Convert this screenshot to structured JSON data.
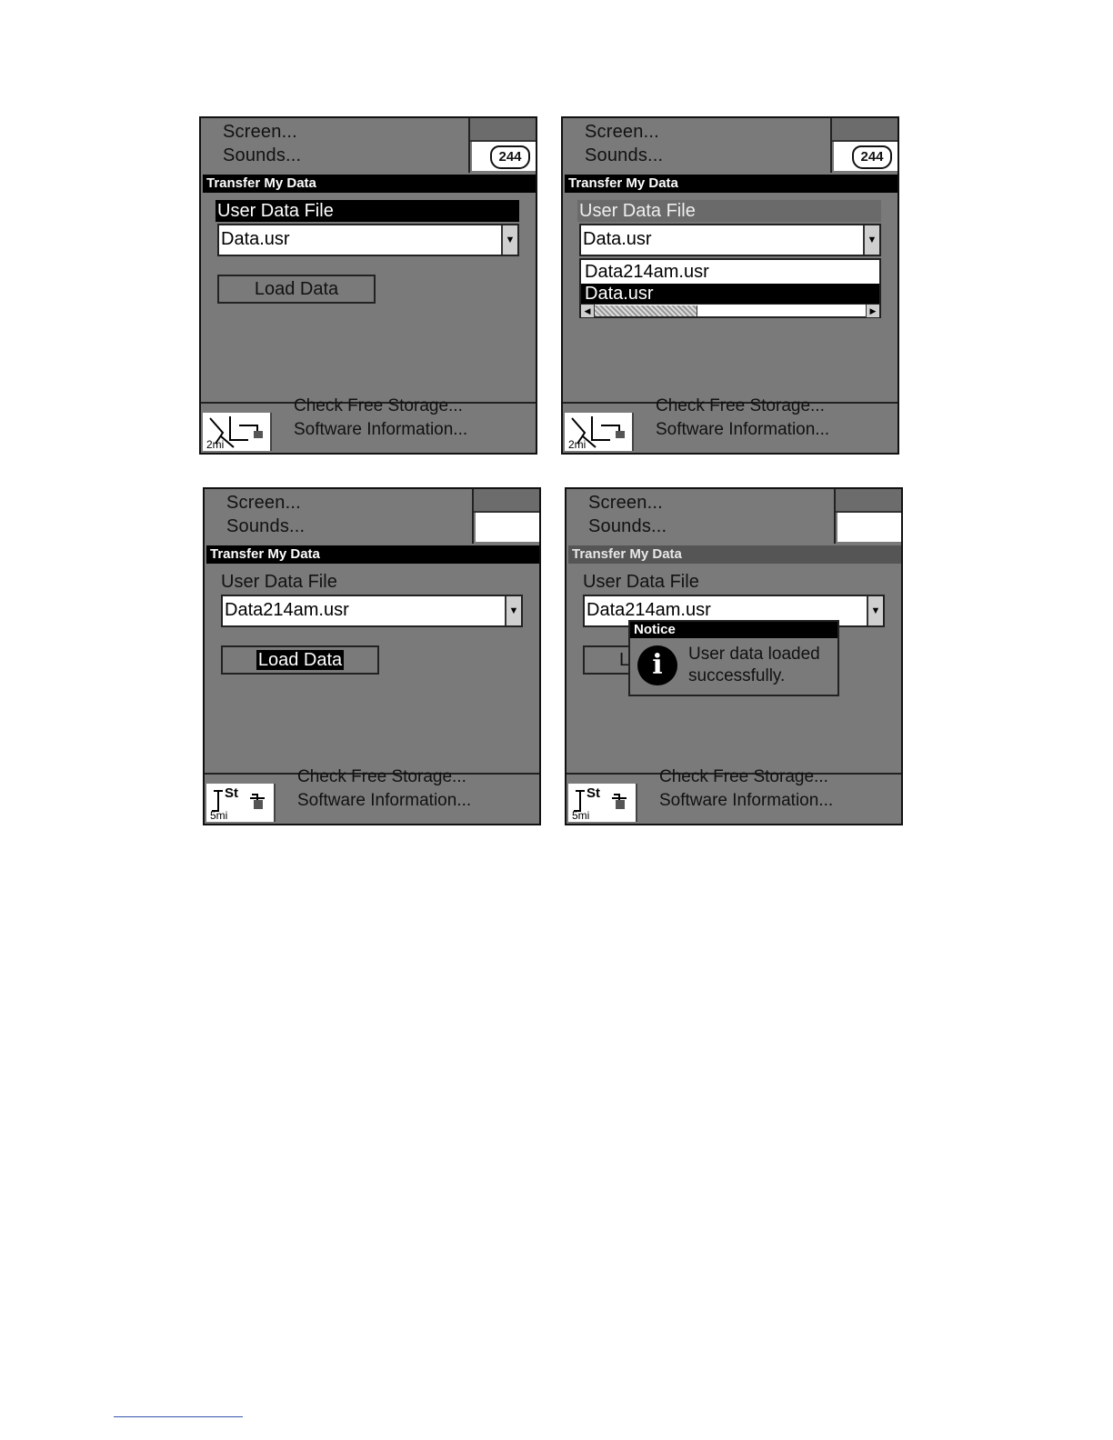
{
  "menu": {
    "screen": "Screen...",
    "sounds": "Sounds..."
  },
  "route_badge": "244",
  "title": "Transfer My Data",
  "section_label": "User Data File",
  "bottom": {
    "check_storage": "Check Free Storage...",
    "software_info": "Software Information..."
  },
  "map_scale_1": "2mi",
  "map_scale_2": "5mi",
  "map_label_st": "St",
  "files": {
    "data": "Data.usr",
    "data214": "Data214am.usr"
  },
  "dropdown_items": [
    "Data214am.usr",
    "Data.usr"
  ],
  "load_button": "Load Data",
  "load_button_peek": "L",
  "notice": {
    "title": "Notice",
    "icon": "i",
    "message": "User data loaded successfully."
  },
  "icons": {
    "dropdown_arrow": "▼",
    "scroll_left": "◀",
    "scroll_right": "▶"
  }
}
